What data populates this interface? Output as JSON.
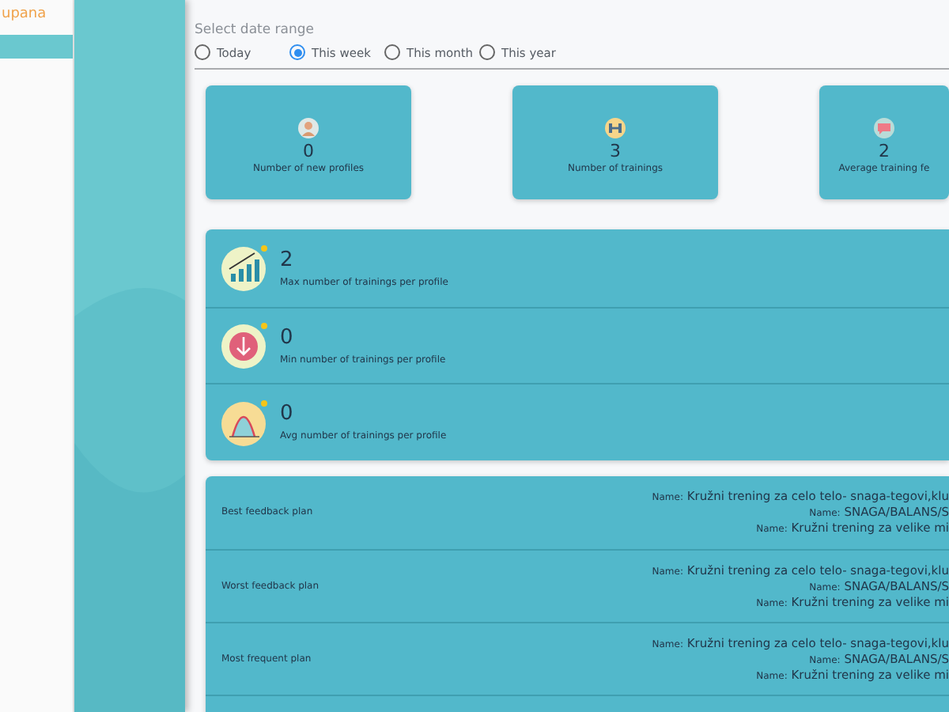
{
  "sidebar": {
    "brand": "upana",
    "items": [
      {
        "selected": true
      }
    ]
  },
  "date_range": {
    "label": "Select date range",
    "options": [
      {
        "label": "Today",
        "selected": false
      },
      {
        "label": "This week",
        "selected": true
      },
      {
        "label": "This month",
        "selected": false
      },
      {
        "label": "This year",
        "selected": false
      }
    ]
  },
  "cards": [
    {
      "kind": "profile",
      "value": "0",
      "label": "Number of new profiles"
    },
    {
      "kind": "dumbbell",
      "value": "3",
      "label": "Number of trainings"
    },
    {
      "kind": "chat",
      "value": "2",
      "label": "Average training fe"
    }
  ],
  "stats": [
    {
      "kind": "growth",
      "value": "2",
      "label": "Max number of trainings per profile"
    },
    {
      "kind": "down",
      "value": "0",
      "label": "Min number of trainings per profile"
    },
    {
      "kind": "curve",
      "value": "0",
      "label": "Avg number of trainings per profile"
    }
  ],
  "plans": [
    {
      "label": "Best feedback plan",
      "names": [
        {
          "key": "Name:",
          "value": "Kružni trening za celo telo- snaga-tegovi,klu"
        },
        {
          "key": "Name:",
          "value": "SNAGA/BALANS/S"
        },
        {
          "key": "Name:",
          "value": "Kružni trening za velike mi"
        }
      ]
    },
    {
      "label": "Worst feedback plan",
      "names": [
        {
          "key": "Name:",
          "value": "Kružni trening za celo telo- snaga-tegovi,klu"
        },
        {
          "key": "Name:",
          "value": "SNAGA/BALANS/S"
        },
        {
          "key": "Name:",
          "value": "Kružni trening za velike mi"
        }
      ]
    },
    {
      "label": "Most frequent plan",
      "names": [
        {
          "key": "Name:",
          "value": "Kružni trening za celo telo- snaga-tegovi,klu"
        },
        {
          "key": "Name:",
          "value": "SNAGA/BALANS/S"
        },
        {
          "key": "Name:",
          "value": "Kružni trening za velike mi"
        }
      ]
    }
  ]
}
